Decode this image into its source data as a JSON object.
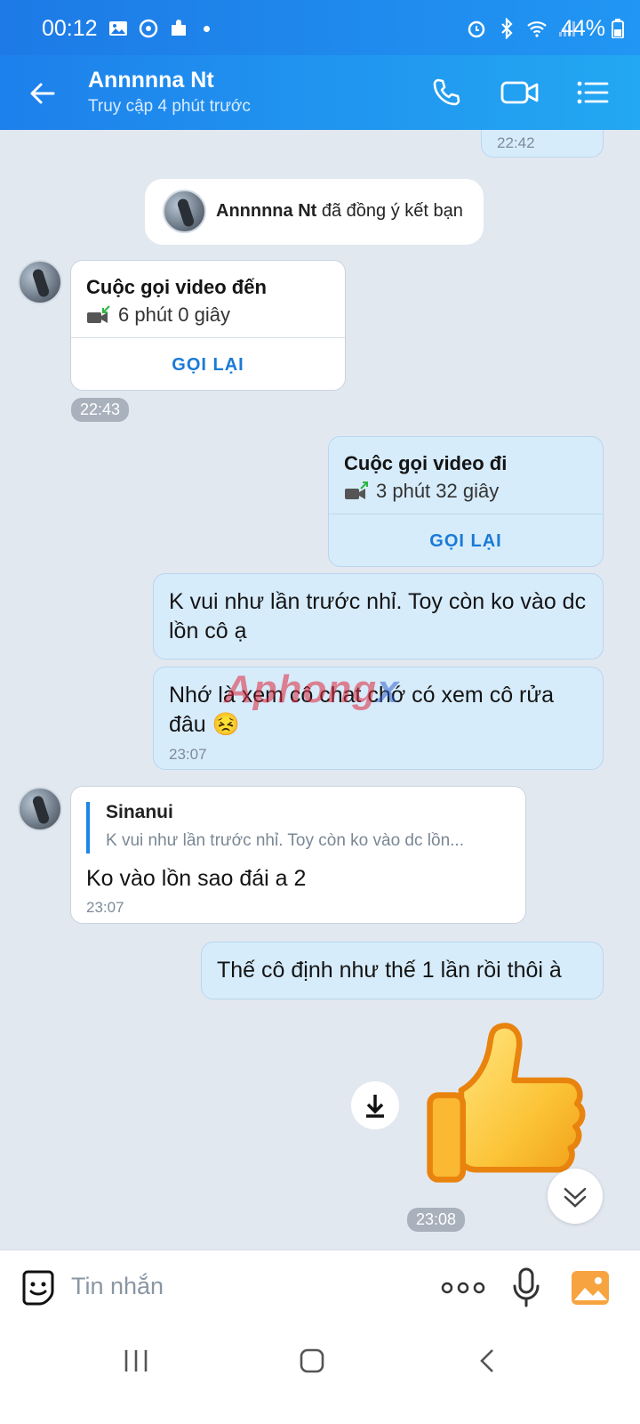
{
  "status": {
    "time": "00:12",
    "battery": "44%"
  },
  "header": {
    "contact_name": "Annnnna Nt",
    "last_seen": "Truy cập 4 phút trước"
  },
  "chat": {
    "top_time": "22:42",
    "friend_notice": {
      "name": "Annnnna Nt",
      "text": "đã đồng ý kết bạn"
    },
    "incoming_call": {
      "title": "Cuộc gọi video đến",
      "duration": "6 phút 0 giây",
      "action": "GỌI LẠI",
      "time": "22:43"
    },
    "outgoing_call": {
      "title": "Cuộc gọi video đi",
      "duration": "3 phút 32 giây",
      "action": "GỌI LẠI"
    },
    "out_msg_1": "K vui như lần trước nhỉ. Toy còn ko vào dc lồn cô ạ",
    "out_msg_2": {
      "text": "Nhớ là xem cô chat chớ có xem cô rửa đâu 😣",
      "time": "23:07"
    },
    "reply_msg": {
      "quoted_author": "Sinanui",
      "quoted_text": "K vui như lần trước nhỉ. Toy còn ko vào dc lồn...",
      "text": "Ko vào lồn sao đái a 2",
      "time": "23:07"
    },
    "out_msg_3": "Thế cô định như thế 1 lần rồi thôi à",
    "sticker_time": "23:08",
    "watermark": {
      "part1": "Aphong",
      "part2": "x"
    }
  },
  "input": {
    "placeholder": "Tin nhắn"
  }
}
